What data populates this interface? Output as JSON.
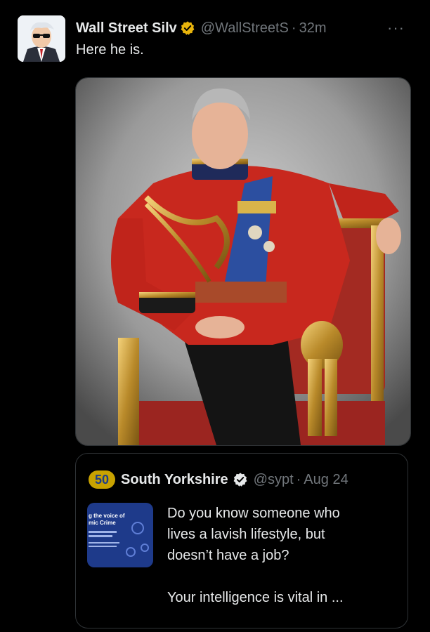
{
  "tweet": {
    "author_name": "Wall Street Silv",
    "handle": "@WallStreetS",
    "separator": "·",
    "time": "32m",
    "more": "···",
    "text": "Here he is."
  },
  "quoted": {
    "logo_text": "50",
    "author_name": "South Yorkshire",
    "handle": "@sypt",
    "separator": "·",
    "date": "Aug 24",
    "thumb_line1": "g the voice of",
    "thumb_line2": "mic Crime",
    "body_lines": [
      "Do you know someone who",
      "lives a lavish lifestyle, but",
      "doesn’t have a job?"
    ],
    "body_line_after_gap": "Your intelligence is vital in ..."
  },
  "colors": {
    "background": "#000000",
    "verified_badge": "#e8b40c",
    "uniform_red": "#c8281e",
    "sash_blue": "#2c4fa0"
  }
}
